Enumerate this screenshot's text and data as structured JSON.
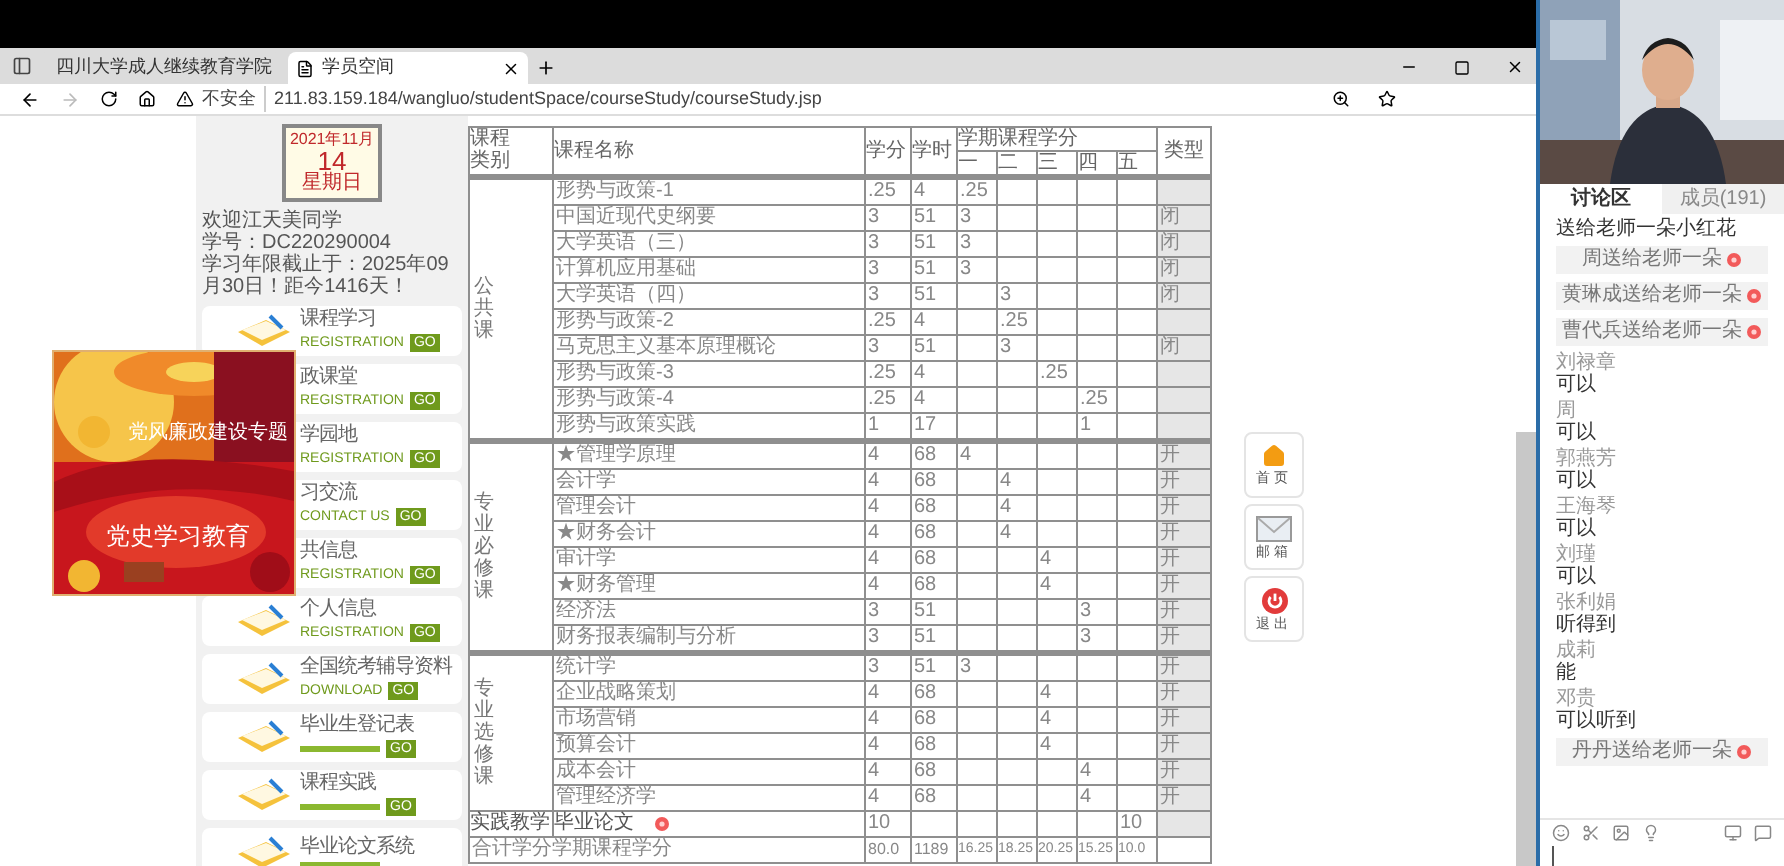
{
  "browser": {
    "tabs": [
      {
        "title": "四川大学成人继续教育学院",
        "selected": false
      },
      {
        "title": "学员空间",
        "selected": true
      }
    ],
    "security": "不安全",
    "url": "211.83.159.184/wangluo/studentSpace/courseStudy/courseStudy.jsp"
  },
  "sidebar": {
    "date": {
      "month": "2021年11月",
      "day": "14",
      "weekday": "星期日"
    },
    "welcome": [
      "欢迎江天美同学",
      "学号：DC220290004",
      "学习年限截止于：2025年09月30日！距今1416天！"
    ],
    "items": [
      {
        "label": "课程学习",
        "kind": "text",
        "sub": "REGISTRATION",
        "badge": "GO"
      },
      {
        "label": "政课堂",
        "kind": "text",
        "sub": "REGISTRATION",
        "badge": "GO"
      },
      {
        "label": "学园地",
        "kind": "text",
        "sub": "REGISTRATION",
        "badge": "GO"
      },
      {
        "label": "习交流",
        "kind": "text",
        "sub": "CONTACT US",
        "badge": "GO"
      },
      {
        "label": "共信息",
        "kind": "text",
        "sub": "REGISTRATION",
        "badge": "GO"
      },
      {
        "label": "个人信息",
        "kind": "text",
        "sub": "REGISTRATION",
        "badge": "GO"
      },
      {
        "label": "全国统考辅导资料",
        "kind": "text",
        "sub": "DOWNLOAD",
        "badge": "GO"
      },
      {
        "label": "毕业生登记表",
        "kind": "bar",
        "badge": "GO"
      },
      {
        "label": "课程实践",
        "kind": "bar",
        "badge": "GO"
      },
      {
        "label": "毕业论文系统",
        "kind": "bar"
      }
    ]
  },
  "banner": {
    "title": "党风廉政建设专题",
    "caption": "党史学习教育"
  },
  "table": {
    "columns": {
      "category": "课程类别",
      "name": "课程名称",
      "credit": "学分",
      "hours": "学时",
      "terms_header": "学期课程学分",
      "terms": [
        "一",
        "二",
        "三",
        "四",
        "五"
      ],
      "type": "类型"
    },
    "groups": [
      {
        "category": "公共课",
        "rows": [
          {
            "name": "形势与政策-1",
            "credit": ".25",
            "hours": "4",
            "t1": ".25"
          },
          {
            "name": "中国近现代史纲要",
            "credit": "3",
            "hours": "51",
            "t1": "3",
            "type": "闭"
          },
          {
            "name": "大学英语（三）",
            "credit": "3",
            "hours": "51",
            "t1": "3",
            "type": "闭"
          },
          {
            "name": "计算机应用基础",
            "credit": "3",
            "hours": "51",
            "t1": "3",
            "type": "闭"
          },
          {
            "name": "大学英语（四）",
            "credit": "3",
            "hours": "51",
            "t2": "3",
            "type": "闭"
          },
          {
            "name": "形势与政策-2",
            "credit": ".25",
            "hours": "4",
            "t2": ".25"
          },
          {
            "name": "马克思主义基本原理概论",
            "credit": "3",
            "hours": "51",
            "t2": "3",
            "type": "闭"
          },
          {
            "name": "形势与政策-3",
            "credit": ".25",
            "hours": "4",
            "t3": ".25"
          },
          {
            "name": "形势与政策-4",
            "credit": ".25",
            "hours": "4",
            "t4": ".25"
          },
          {
            "name": "形势与政策实践",
            "credit": "1",
            "hours": "17",
            "t4": "1"
          }
        ]
      },
      {
        "category": "专业必修课",
        "rows": [
          {
            "name": "★管理学原理",
            "credit": "4",
            "hours": "68",
            "t1": "4",
            "type": "开"
          },
          {
            "name": "会计学",
            "credit": "4",
            "hours": "68",
            "t2": "4",
            "type": "开"
          },
          {
            "name": "管理会计",
            "credit": "4",
            "hours": "68",
            "t2": "4",
            "type": "开"
          },
          {
            "name": "★财务会计",
            "credit": "4",
            "hours": "68",
            "t2": "4",
            "type": "开"
          },
          {
            "name": "审计学",
            "credit": "4",
            "hours": "68",
            "t3": "4",
            "type": "开"
          },
          {
            "name": "★财务管理",
            "credit": "4",
            "hours": "68",
            "t3": "4",
            "type": "开"
          },
          {
            "name": "经济法",
            "credit": "3",
            "hours": "51",
            "t4": "3",
            "type": "开"
          },
          {
            "name": "财务报表编制与分析",
            "credit": "3",
            "hours": "51",
            "t4": "3",
            "type": "开"
          }
        ]
      },
      {
        "category": "专业选修课",
        "rows": [
          {
            "name": "统计学",
            "credit": "3",
            "hours": "51",
            "t1": "3",
            "type": "开"
          },
          {
            "name": "企业战略策划",
            "credit": "4",
            "hours": "68",
            "t3": "4",
            "type": "开"
          },
          {
            "name": "市场营销",
            "credit": "4",
            "hours": "68",
            "t3": "4",
            "type": "开"
          },
          {
            "name": "预算会计",
            "credit": "4",
            "hours": "68",
            "t3": "4",
            "type": "开"
          },
          {
            "name": "成本会计",
            "credit": "4",
            "hours": "68",
            "t4": "4",
            "type": "开"
          },
          {
            "name": "管理经济学",
            "credit": "4",
            "hours": "68",
            "t4": "4",
            "type": "开"
          }
        ]
      }
    ],
    "practice": {
      "category": "实践教学",
      "name": "毕业论文",
      "credit": "10",
      "t5": "10"
    },
    "total": {
      "label": "合计学分学期课程学分",
      "credit": "80.0",
      "hours": "1189",
      "t1": "16.25",
      "t2": "18.25",
      "t3": "20.25",
      "t4": "15.25",
      "t5": "10.0"
    }
  },
  "side_buttons": [
    {
      "label": "首页",
      "kind": "home"
    },
    {
      "label": "邮箱",
      "kind": "mail"
    },
    {
      "label": "退出",
      "kind": "exit"
    }
  ],
  "meeting": {
    "tabs": [
      {
        "label": "讨论区",
        "selected": true
      },
      {
        "label": "成员(191)",
        "selected": false
      }
    ],
    "messages": [
      {
        "kind": "line",
        "text": "送给老师一朵小红花"
      },
      {
        "kind": "gift",
        "text": "周送给老师一朵"
      },
      {
        "kind": "gift",
        "text": "黄琳成送给老师一朵"
      },
      {
        "kind": "gift",
        "text": "曹代兵送给老师一朵"
      },
      {
        "kind": "chat",
        "name": "刘禄章",
        "text": "可以"
      },
      {
        "kind": "chat",
        "name": "周",
        "text": "可以"
      },
      {
        "kind": "chat",
        "name": "郭燕芳",
        "text": "可以"
      },
      {
        "kind": "chat",
        "name": "王海琴",
        "text": "可以"
      },
      {
        "kind": "chat",
        "name": "刘瑾",
        "text": "可以"
      },
      {
        "kind": "chat",
        "name": "张利娟",
        "text": "听得到"
      },
      {
        "kind": "chat",
        "name": "成莉",
        "text": "能"
      },
      {
        "kind": "chat",
        "name": "邓贵",
        "text": "可以听到"
      },
      {
        "kind": "gift",
        "text": "丹丹送给老师一朵"
      }
    ]
  }
}
